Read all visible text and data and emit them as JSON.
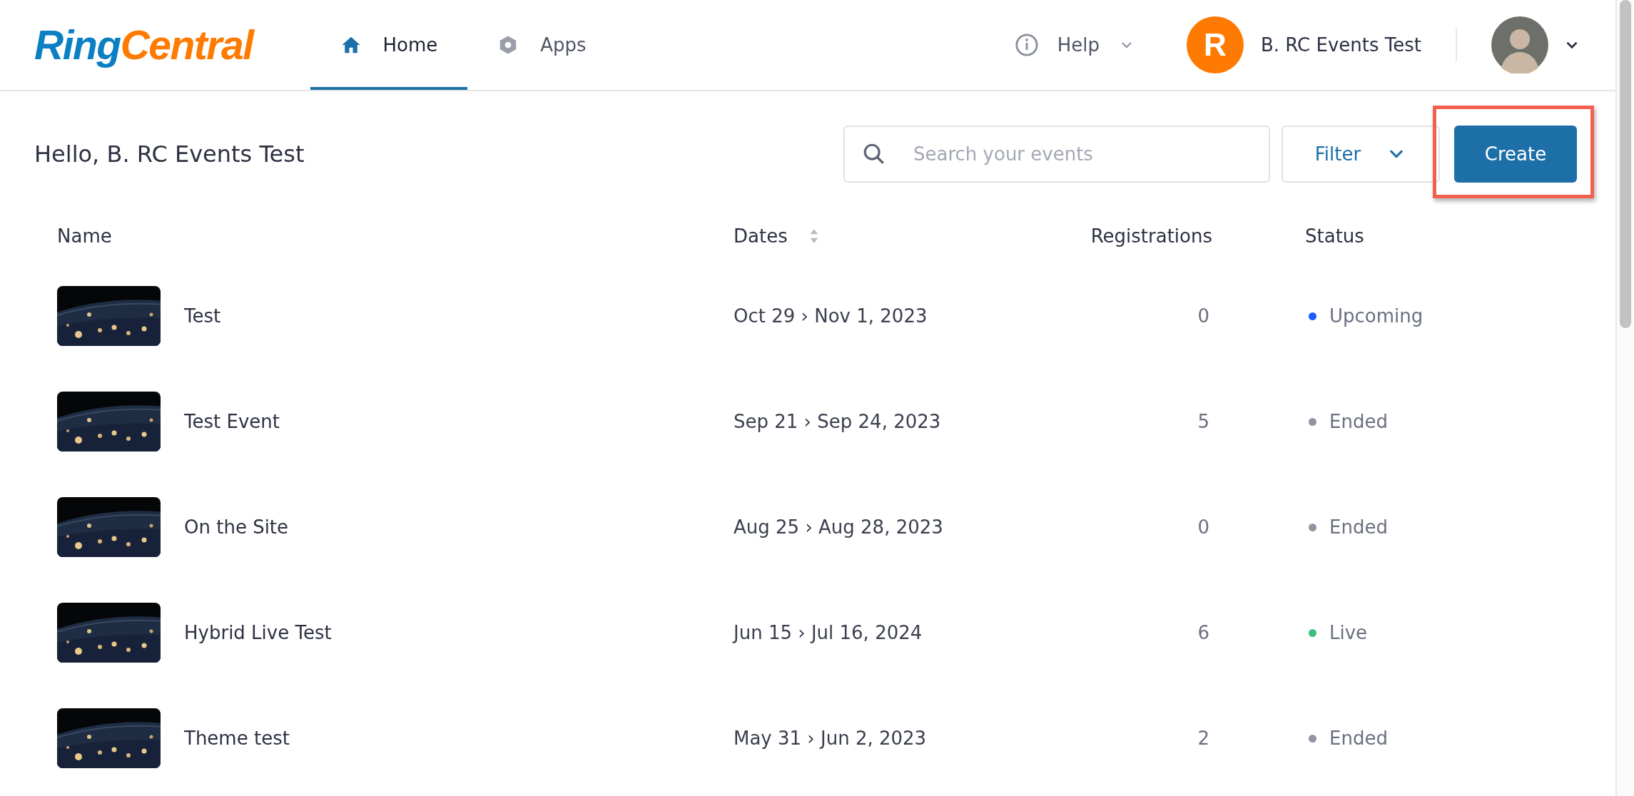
{
  "logo": [
    "Ring",
    "Central"
  ],
  "nav": [
    {
      "label": "Home",
      "selected": true
    },
    {
      "label": "Apps",
      "selected": false
    }
  ],
  "help": {
    "label": "Help"
  },
  "account": {
    "badge": "R",
    "name": "B. RC Events Test"
  },
  "greeting": "Hello, B. RC Events Test",
  "search": {
    "placeholder": "Search your events"
  },
  "filter": {
    "label": "Filter"
  },
  "create": {
    "label": "Create",
    "highlighted": true
  },
  "columns": [
    {
      "label": "Name",
      "sortable": false
    },
    {
      "label": "Dates",
      "sortable": true
    },
    {
      "label": "Registrations",
      "sortable": false
    },
    {
      "label": "Status",
      "sortable": false
    }
  ],
  "rows": [
    {
      "name": "Test",
      "dates": "Oct 29 › Nov 1, 2023",
      "registrations": "0",
      "status": {
        "label": "Upcoming",
        "color": "#1a5cff"
      }
    },
    {
      "name": "Test Event",
      "dates": "Sep 21 › Sep 24, 2023",
      "registrations": "5",
      "status": {
        "label": "Ended",
        "color": "#9095a3"
      }
    },
    {
      "name": "On the Site",
      "dates": "Aug 25 › Aug 28, 2023",
      "registrations": "0",
      "status": {
        "label": "Ended",
        "color": "#9095a3"
      }
    },
    {
      "name": "Hybrid Live Test",
      "dates": "Jun 15 › Jul 16, 2024",
      "registrations": "6",
      "status": {
        "label": "Live",
        "color": "#3fbf7f"
      }
    },
    {
      "name": "Theme test",
      "dates": "May 31 › Jun 2, 2023",
      "registrations": "2",
      "status": {
        "label": "Ended",
        "color": "#9095a3"
      }
    }
  ]
}
